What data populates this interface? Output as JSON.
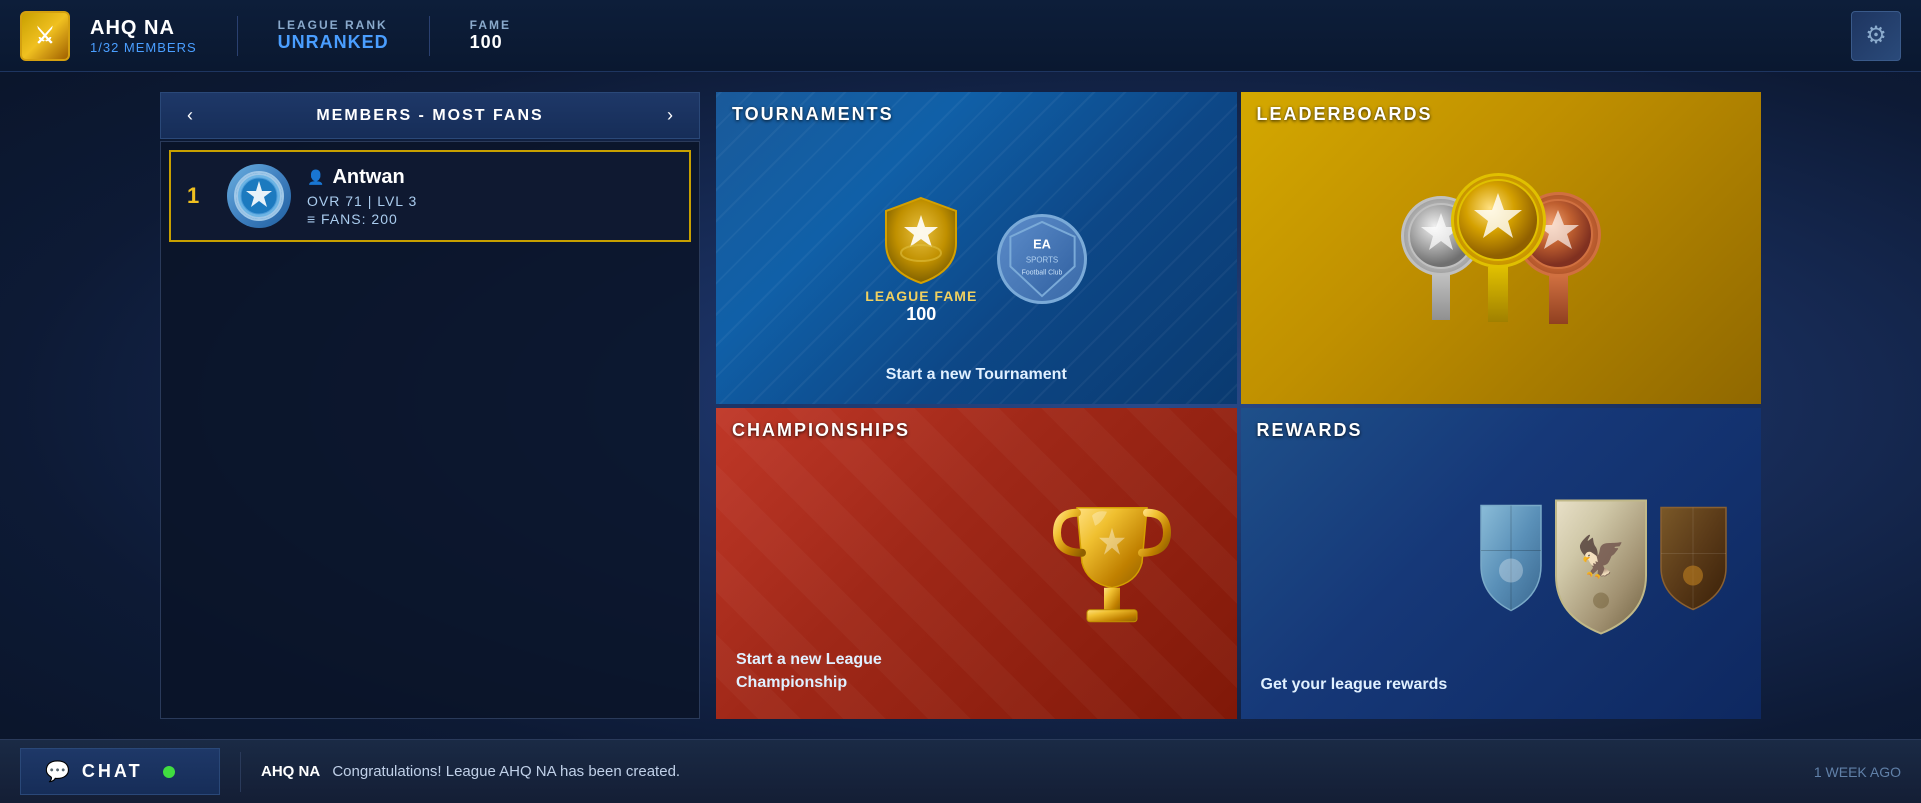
{
  "header": {
    "club_name": "AHQ NA",
    "members_count": "1/32 MEMBERS",
    "league_rank_label": "LEAGUE RANK",
    "league_rank_value": "UNRANKED",
    "fame_label": "FAME",
    "fame_value": "100",
    "settings_icon": "⚙"
  },
  "members_panel": {
    "title": "MEMBERS - MOST FANS",
    "prev_arrow": "‹",
    "next_arrow": "›",
    "members": [
      {
        "rank": "1",
        "name": "Antwan",
        "ovr": "OVR 71 | LVL 3",
        "fans": "FANS: 200"
      }
    ]
  },
  "tournaments": {
    "label": "TOURNAMENTS",
    "fame_label": "LEAGUE FAME",
    "fame_value": "100",
    "ea_text": "EA",
    "sports_text": "SPORTS",
    "fc_text": "Football Club",
    "action": "Start a new Tournament"
  },
  "leaderboards": {
    "label": "LEADERBOARDS"
  },
  "championships": {
    "label": "CHAMPIONSHIPS",
    "action": "Start a new League Championship"
  },
  "rewards": {
    "label": "REWARDS",
    "action": "Get your league rewards"
  },
  "chat_bar": {
    "icon": "💬",
    "label": "CHAT",
    "sender": "AHQ NA",
    "message": "Congratulations! League AHQ NA has been created.",
    "timestamp": "1 WEEK AGO"
  }
}
